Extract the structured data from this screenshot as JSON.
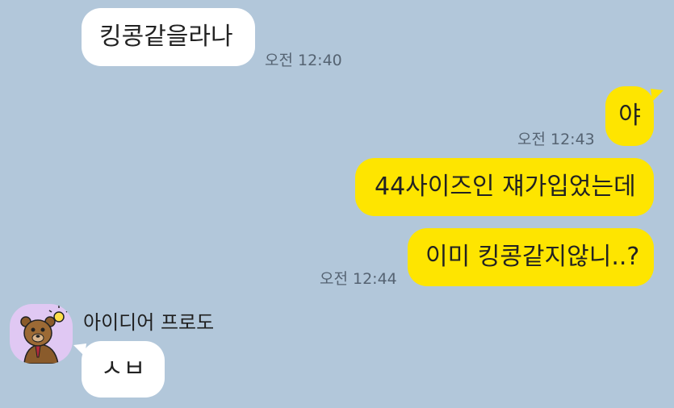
{
  "chat": {
    "messages": [
      {
        "side": "incoming",
        "text": "킹콩같을라나",
        "time": "오전 12:40"
      },
      {
        "side": "outgoing",
        "text": "야",
        "time": "오전 12:43"
      },
      {
        "side": "outgoing",
        "text": "44사이즈인 쟤가입었는데",
        "time": ""
      },
      {
        "side": "outgoing",
        "text": "이미 킹콩같지않니..?",
        "time": "오전 12:44"
      },
      {
        "side": "incoming",
        "sender": "아이디어 프로도",
        "text": "ㅅㅂ",
        "time": ""
      }
    ]
  },
  "colors": {
    "background": "#b2c7da",
    "incoming_bubble": "#ffffff",
    "outgoing_bubble": "#fee500"
  },
  "icons": {
    "avatar": "frodo-character-avatar-icon"
  }
}
